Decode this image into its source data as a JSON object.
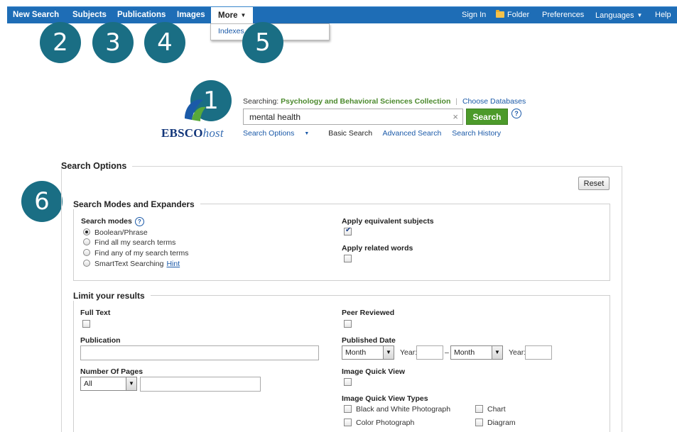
{
  "nav": {
    "left": [
      "New Search",
      "Subjects",
      "Publications",
      "Images"
    ],
    "more": "More",
    "right": {
      "sign_in": "Sign In",
      "folder": "Folder",
      "preferences": "Preferences",
      "languages": "Languages",
      "help": "Help"
    },
    "more_menu": [
      "Indexes"
    ]
  },
  "callouts": [
    "1",
    "2",
    "3",
    "4",
    "5",
    "6"
  ],
  "search": {
    "logo_main": "EBSCO",
    "logo_host": "host",
    "searching_label": "Searching:",
    "database": "Psychology and Behavioral Sciences Collection",
    "choose_databases": "Choose Databases",
    "query": "mental health",
    "clear": "×",
    "button": "Search",
    "help": "?",
    "links": {
      "options": "Search Options",
      "basic": "Basic Search",
      "advanced": "Advanced Search",
      "history": "Search History"
    }
  },
  "options": {
    "title": "Search Options",
    "reset": "Reset",
    "modes_section": {
      "title": "Search Modes and Expanders",
      "modes_label": "Search modes",
      "modes": [
        "Boolean/Phrase",
        "Find all my search terms",
        "Find any of my search terms",
        "SmartText Searching"
      ],
      "selected_index": 0,
      "hint": "Hint",
      "equivalent_subjects": "Apply equivalent subjects",
      "equivalent_checked": true,
      "related_words": "Apply related words",
      "related_checked": false
    },
    "limit_section": {
      "title": "Limit your results",
      "full_text": "Full Text",
      "peer_reviewed": "Peer Reviewed",
      "publication": "Publication",
      "published_date": "Published Date",
      "month": "Month",
      "year": "Year:",
      "dash": "–",
      "number_of_pages": "Number Of Pages",
      "pages_select": "All",
      "image_quick_view": "Image Quick View",
      "image_quick_view_types": "Image Quick View Types",
      "image_types": [
        "Black and White Photograph",
        "Chart",
        "Color Photograph",
        "Diagram"
      ]
    }
  },
  "colors": {
    "nav_bar": "#1e6db6",
    "callout": "#1a6e84",
    "search_button": "#4c9a2a",
    "link": "#1a59a8",
    "database_text": "#4c8a2e"
  }
}
